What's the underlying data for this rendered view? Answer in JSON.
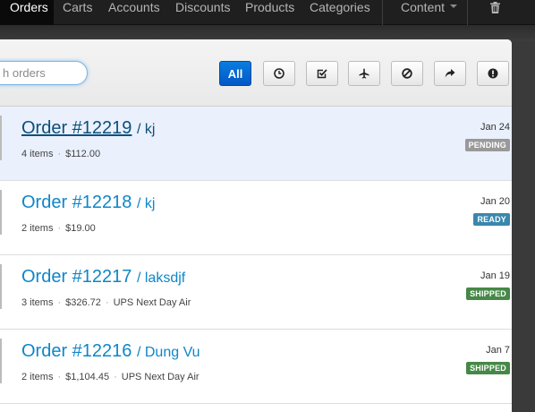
{
  "nav": {
    "items": [
      {
        "label": "Orders",
        "active": true
      },
      {
        "label": "Carts"
      },
      {
        "label": "Accounts"
      },
      {
        "label": "Discounts"
      },
      {
        "label": "Products"
      },
      {
        "label": "Categories"
      },
      {
        "label": "Content",
        "dropdown": true
      }
    ],
    "trash_icon": "trash-icon"
  },
  "toolbar": {
    "search_placeholder": "h orders",
    "filters": [
      {
        "label": "All",
        "active": true
      },
      {
        "icon": "clock-icon"
      },
      {
        "icon": "check-square-icon"
      },
      {
        "icon": "plane-icon"
      },
      {
        "icon": "ban-icon"
      },
      {
        "icon": "share-arrow-icon"
      },
      {
        "icon": "exclamation-icon"
      }
    ]
  },
  "orders": [
    {
      "number": "Order #12219",
      "customer": "/ kj",
      "items": "4 items",
      "total": "$112.00",
      "shipping": "",
      "date": "Jan 24",
      "status": "PENDING",
      "selected": true
    },
    {
      "number": "Order #12218",
      "customer": "/ kj",
      "items": "2 items",
      "total": "$19.00",
      "shipping": "",
      "date": "Jan 20",
      "status": "READY"
    },
    {
      "number": "Order #12217",
      "customer": "/ laksdjf",
      "items": "3 items",
      "total": "$326.72",
      "shipping": "UPS Next Day Air",
      "date": "Jan 19",
      "status": "SHIPPED"
    },
    {
      "number": "Order #12216",
      "customer": "/ Dung Vu",
      "items": "2 items",
      "total": "$1,104.45",
      "shipping": "UPS Next Day Air",
      "date": "Jan 7",
      "status": "SHIPPED"
    }
  ],
  "colors": {
    "pending": "#999999",
    "ready": "#3a87ad",
    "shipped": "#468847",
    "link": "#0f86c8",
    "primary": "#0068d6"
  }
}
